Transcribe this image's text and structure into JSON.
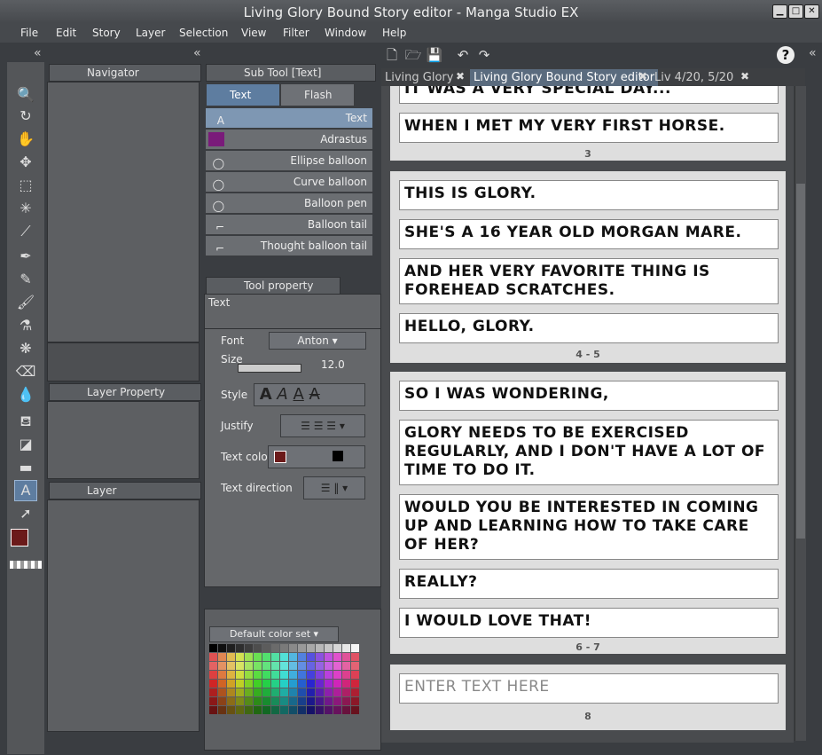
{
  "window": {
    "title": "Living Glory Bound Story editor - Manga Studio EX"
  },
  "menu": [
    "File",
    "Edit",
    "Story",
    "Layer",
    "Selection",
    "View",
    "Filter",
    "Window",
    "Help"
  ],
  "panels": {
    "navigator": {
      "title": "Navigator"
    },
    "layer_property": {
      "title": "Layer Property"
    },
    "layer": {
      "title": "Layer"
    },
    "sub_tool": {
      "title": "Sub Tool [Text]",
      "groups": [
        "Text",
        "Flash"
      ],
      "items": [
        "Text",
        "Adrastus",
        "Ellipse balloon",
        "Curve balloon",
        "Balloon pen",
        "Balloon tail",
        "Thought balloon tail"
      ]
    },
    "tool_property": {
      "title": "Tool property [Text]",
      "subtitle": "Text",
      "font_label": "Font",
      "font_value": "Anton",
      "size_label": "Size",
      "size_value": "12.0",
      "style_label": "Style",
      "justify_label": "Justify",
      "text_color_label": "Text color",
      "text_direction_label": "Text direction"
    },
    "color_set": {
      "selected": "Default color set"
    }
  },
  "doc_tabs": [
    "Living Glory",
    "Living Glory Bound Story editor",
    "Liv 4/20, 5/20"
  ],
  "story": {
    "pages": [
      {
        "number": "3",
        "texts": [
          "IT WAS A VERY SPECIAL DAY...",
          "WHEN I MET MY VERY FIRST HORSE."
        ]
      },
      {
        "number": "4 - 5",
        "texts": [
          "THIS IS GLORY.",
          "SHE'S A 16 YEAR OLD MORGAN MARE.",
          "AND HER VERY FAVORITE THING IS FOREHEAD SCRATCHES.",
          "HELLO, GLORY."
        ]
      },
      {
        "number": "6 - 7",
        "texts": [
          "SO I WAS WONDERING,",
          "GLORY NEEDS TO BE EXERCISED REGULARLY, AND I DON'T HAVE A LOT OF TIME TO DO IT.",
          "WOULD YOU BE INTERESTED IN COMING UP AND LEARNING HOW TO TAKE CARE OF HER?",
          "REALLY?",
          "I WOULD LOVE THAT!"
        ]
      },
      {
        "number": "8",
        "texts": [
          "ENTER TEXT HERE"
        ]
      }
    ]
  },
  "colors": {
    "text_color": "#6b1a1a",
    "main_color": "#6b1a1a",
    "accent": "#5e7da0"
  }
}
